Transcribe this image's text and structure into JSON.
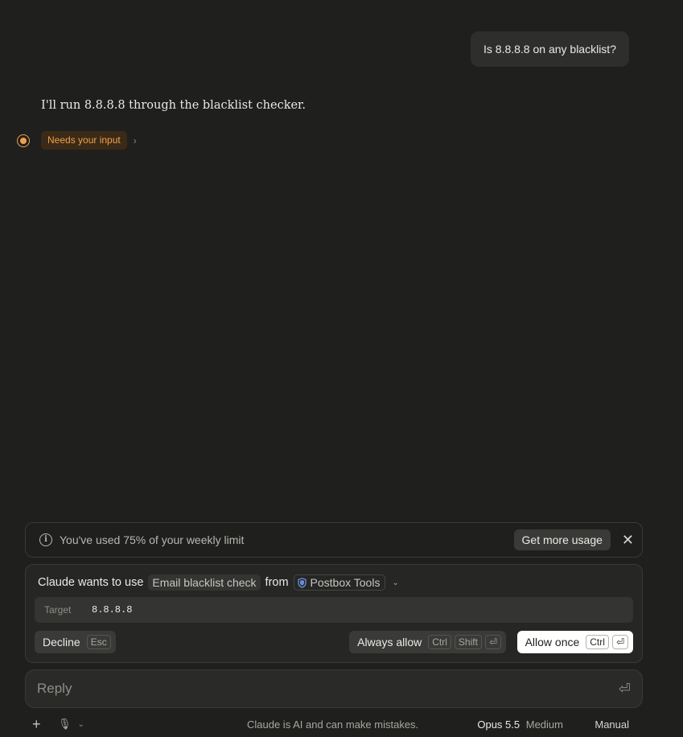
{
  "conversation": {
    "user_message": "Is 8.8.8.8 on any blacklist?",
    "assistant_message": "I'll run 8.8.8.8 through the blacklist checker.",
    "status_label": "Needs your input"
  },
  "usage_notice": {
    "text": "You've used 75% of your weekly limit",
    "cta_label": "Get more usage"
  },
  "permission": {
    "prefix": "Claude wants to use",
    "tool_name": "Email blacklist check",
    "from_label": "from",
    "source_name": "Postbox Tools",
    "param_key": "Target",
    "param_value": "8.8.8.8",
    "decline_label": "Decline",
    "decline_key": "Esc",
    "always_label": "Always allow",
    "always_keys": [
      "Ctrl",
      "Shift",
      "⏎"
    ],
    "once_label": "Allow once",
    "once_keys": [
      "Ctrl",
      "⏎"
    ]
  },
  "composer": {
    "placeholder": "Reply"
  },
  "footer": {
    "disclaimer": "Claude is AI and can make mistakes.",
    "model": "Opus 5.5",
    "effort": "Medium",
    "mode": "Manual"
  },
  "colors": {
    "background": "#1f1f1e",
    "accent_orange": "#f0a04b",
    "shield_blue": "#6b8fd6"
  }
}
